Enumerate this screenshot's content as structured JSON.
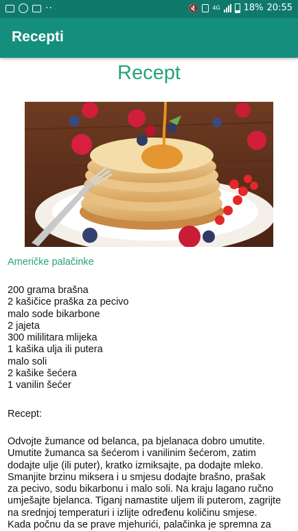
{
  "status_bar": {
    "network": "4G",
    "battery": "18%",
    "time": "20:55",
    "icons_left": [
      "image-icon",
      "whatsapp-icon",
      "gallery-icon",
      "more-dots-icon"
    ],
    "icons_right": [
      "mute-icon",
      "sim-icon",
      "signal-icon",
      "battery-icon"
    ]
  },
  "app_bar": {
    "title": "Recepti"
  },
  "page": {
    "heading": "Recept",
    "recipe_name": "Američke palačinke",
    "ingredients": [
      "200 grama brašna",
      "2 kašičice praška za pecivo",
      "malo sode bikarbone",
      "2 jajeta",
      "300 mililitara mlijeka",
      "1 kašika ulja ili putera",
      "malo soli",
      "2 kašike šećera",
      "1 vanilin šećer"
    ],
    "recept_label": "Recept:",
    "instructions": [
      "Odvojte žumance od belanca, pa bjelanaca dobro umutite.",
      "Umutite žumanca sa šećerom i vanilinim šećerom, zatim",
      "dodajte ulje (ili puter), kratko izmiksajte, pa dodajte mleko.",
      "Smanjite brzinu miksera i u smjesu dodajte brašno, prašak",
      "za pecivo, sodu bikarbonu i malo soli. Na kraju lagano ručno",
      "umješajte bjelanca. Tiganj namastite uljem ili puterom, zagrijte",
      "na srednjoj temperaturi i izlijte određenu količinu smjese.",
      "Kada počnu da se prave mjehurići, palačinka je spremna za"
    ]
  },
  "colors": {
    "status_bar": "#0f7a6c",
    "app_bar": "#148f7e",
    "accent_text": "#22a37a"
  }
}
